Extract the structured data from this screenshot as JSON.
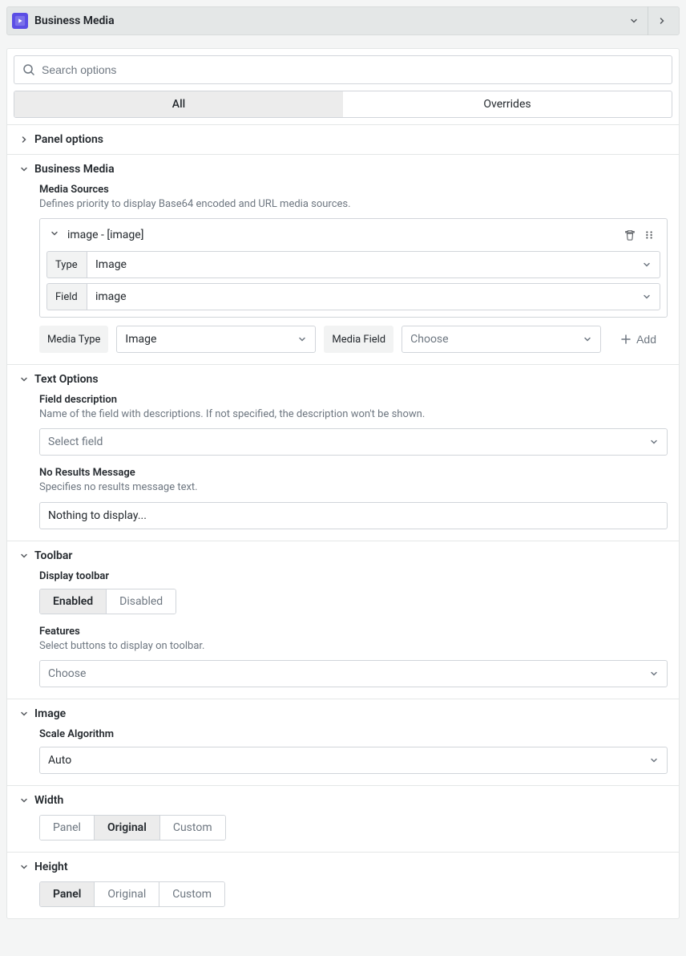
{
  "header": {
    "title": "Business Media"
  },
  "search": {
    "placeholder": "Search options"
  },
  "tabs": {
    "all": "All",
    "overrides": "Overrides"
  },
  "sections": {
    "panel_options": {
      "title": "Panel options"
    },
    "business_media": {
      "title": "Business Media",
      "media_sources": {
        "label": "Media Sources",
        "desc": "Defines priority to display Base64 encoded and URL media sources.",
        "item_title": "image - [image]",
        "type_label": "Type",
        "type_value": "Image",
        "field_label": "Field",
        "field_value": "image"
      },
      "media_type": {
        "label": "Media Type",
        "value": "Image"
      },
      "media_field": {
        "label": "Media Field",
        "placeholder": "Choose"
      },
      "add_label": "Add"
    },
    "text_options": {
      "title": "Text Options",
      "field_description": {
        "label": "Field description",
        "desc": "Name of the field with descriptions. If not specified, the description won't be shown.",
        "placeholder": "Select field"
      },
      "no_results": {
        "label": "No Results Message",
        "desc": "Specifies no results message text.",
        "value": "Nothing to display..."
      }
    },
    "toolbar": {
      "title": "Toolbar",
      "display_toolbar": {
        "label": "Display toolbar",
        "enabled": "Enabled",
        "disabled": "Disabled"
      },
      "features": {
        "label": "Features",
        "desc": "Select buttons to display on toolbar.",
        "placeholder": "Choose"
      }
    },
    "image": {
      "title": "Image",
      "scale": {
        "label": "Scale Algorithm",
        "value": "Auto"
      }
    },
    "width": {
      "title": "Width",
      "options": {
        "panel": "Panel",
        "original": "Original",
        "custom": "Custom"
      }
    },
    "height": {
      "title": "Height",
      "options": {
        "panel": "Panel",
        "original": "Original",
        "custom": "Custom"
      }
    }
  }
}
